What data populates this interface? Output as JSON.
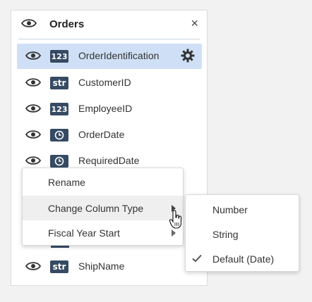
{
  "panel": {
    "title": "Orders",
    "close_glyph": "×"
  },
  "fields": [
    {
      "name": "OrderIdentification",
      "type": "123",
      "selected": true
    },
    {
      "name": "CustomerID",
      "type": "str"
    },
    {
      "name": "EmployeeID",
      "type": "123"
    },
    {
      "name": "OrderDate",
      "type": "date"
    },
    {
      "name": "RequiredDate",
      "type": "date"
    },
    {
      "name": "ShipName",
      "type": "str"
    }
  ],
  "context_menu": {
    "items": [
      {
        "label": "Rename"
      },
      {
        "label": "Change Column Type",
        "has_submenu": true,
        "hover": true
      },
      {
        "label": "Fiscal Year Start",
        "has_submenu": true
      }
    ]
  },
  "column_type_menu": {
    "items": [
      {
        "label": "Number"
      },
      {
        "label": "String"
      },
      {
        "label": "Default (Date)",
        "checked": true
      }
    ]
  },
  "icons": {
    "visibility": "eye-icon",
    "settings": "gear-icon",
    "close": "close-icon",
    "date_type": "clock-icon",
    "check": "checkmark-icon",
    "cursor": "hand-pointer-icon"
  },
  "colors": {
    "selected_row": "#cfe0f6",
    "type_badge": "#364a63"
  }
}
